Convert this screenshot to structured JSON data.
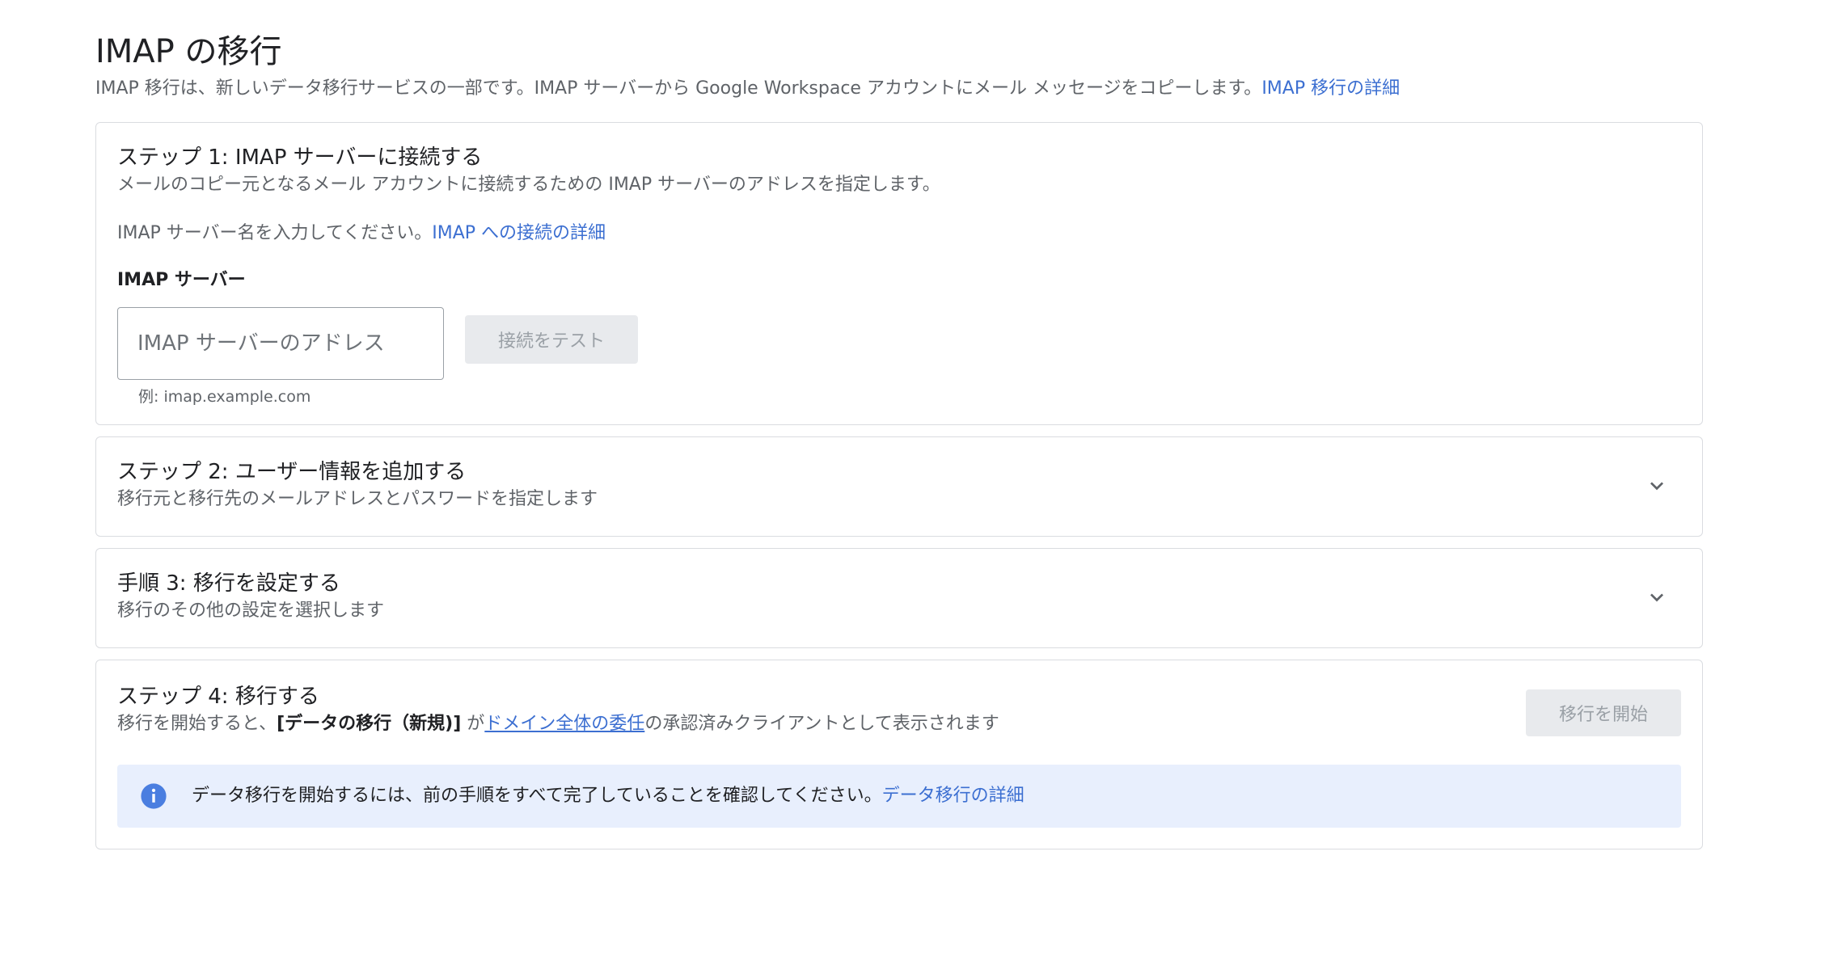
{
  "page": {
    "title": "IMAP の移行",
    "description": "IMAP 移行は、新しいデータ移行サービスの一部です。IMAP サーバーから Google Workspace アカウントにメール メッセージをコピーします。",
    "description_link": "IMAP 移行の詳細"
  },
  "step1": {
    "title": "ステップ 1: IMAP サーバーに接続する",
    "subtitle": "メールのコピー元となるメール アカウントに接続するための IMAP サーバーのアドレスを指定します。",
    "hint": "IMAP サーバー名を入力してください。",
    "hint_link": "IMAP への接続の詳細",
    "field_label": "IMAP サーバー",
    "input_placeholder": "IMAP サーバーのアドレス",
    "input_value": "",
    "test_button": "接続をテスト",
    "example": "例: imap.example.com"
  },
  "step2": {
    "title": "ステップ 2: ユーザー情報を追加する",
    "subtitle": "移行元と移行先のメールアドレスとパスワードを指定します",
    "icon": "chevron-down-icon"
  },
  "step3": {
    "title": "手順 3: 移行を設定する",
    "subtitle": "移行のその他の設定を選択します",
    "icon": "chevron-down-icon"
  },
  "step4": {
    "title": "ステップ 4: 移行する",
    "subtitle_prefix": "移行を開始すると、",
    "subtitle_bold": "[データの移行（新規)]",
    "subtitle_middle": " が",
    "subtitle_link": "ドメイン全体の委任",
    "subtitle_suffix": "の承認済みクライアントとして表示されます",
    "start_button": "移行を開始",
    "info_icon": "info-icon",
    "info_text": "データ移行を開始するには、前の手順をすべて完了していることを確認してください。",
    "info_link": "データ移行の詳細"
  },
  "colors": {
    "link": "#3c6fd1",
    "info_banner_bg": "#e8effd",
    "info_icon": "#4a7ee0",
    "disabled_button_bg": "#e8eaed",
    "disabled_button_text": "#9aa0a6",
    "card_border": "#dadce0"
  }
}
